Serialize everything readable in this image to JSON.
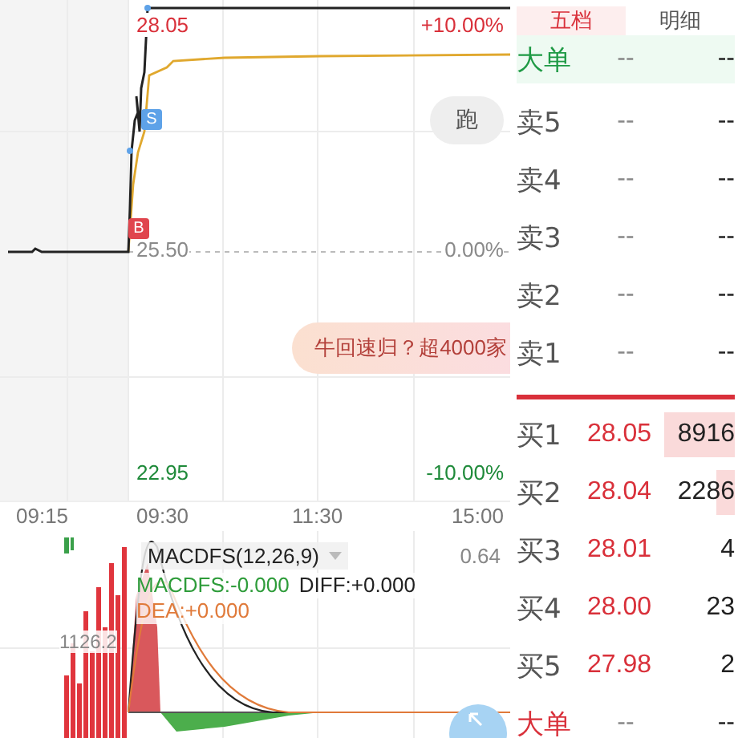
{
  "chart": {
    "labels": [
      {
        "text": "28.05",
        "kind": "up"
      },
      {
        "text": "+10.00%",
        "kind": "up"
      },
      {
        "text": "25.50",
        "kind": "flat"
      },
      {
        "text": "0.00%",
        "kind": "flat"
      },
      {
        "text": "22.95",
        "kind": "down"
      },
      {
        "text": "-10.00%",
        "kind": "down"
      }
    ],
    "markers": [
      {
        "text": "B",
        "kind": "buy"
      },
      {
        "text": "S",
        "kind": "sell"
      }
    ],
    "run_button": "跑",
    "banner": "牛回速归？超4000家"
  },
  "time_axis": [
    "09:15",
    "09:30",
    "11:30",
    "15:00"
  ],
  "indicator": {
    "name": "MACDFS(12,26,9)",
    "max": "0.64",
    "volume_label": "1126.2",
    "values": [
      {
        "text": "MACDFS:-0.000",
        "kind": "macd"
      },
      {
        "text": "DIFF:+0.000",
        "kind": "diff"
      },
      {
        "text": "DEA:+0.000",
        "kind": "dea"
      }
    ]
  },
  "order_book": {
    "tabs": [
      {
        "label": "五档",
        "selected": true
      },
      {
        "label": "明细",
        "selected": false
      }
    ],
    "big_order": {
      "label": "大单",
      "price": "--",
      "volume": "--"
    },
    "asks": [
      {
        "label": "卖5",
        "price": "--",
        "volume": "--"
      },
      {
        "label": "卖4",
        "price": "--",
        "volume": "--"
      },
      {
        "label": "卖3",
        "price": "--",
        "volume": "--"
      },
      {
        "label": "卖2",
        "price": "--",
        "volume": "--"
      },
      {
        "label": "卖1",
        "price": "--",
        "volume": "--"
      }
    ],
    "bids": [
      {
        "label": "买1",
        "price": "28.05",
        "volume": "8916"
      },
      {
        "label": "买2",
        "price": "28.04",
        "volume": "2286"
      },
      {
        "label": "买3",
        "price": "28.01",
        "volume": "4"
      },
      {
        "label": "买4",
        "price": "28.00",
        "volume": "23"
      },
      {
        "label": "买5",
        "price": "27.98",
        "volume": "2"
      }
    ],
    "bottom_big_order": {
      "label": "大单",
      "price": "--",
      "volume": "--"
    }
  }
}
